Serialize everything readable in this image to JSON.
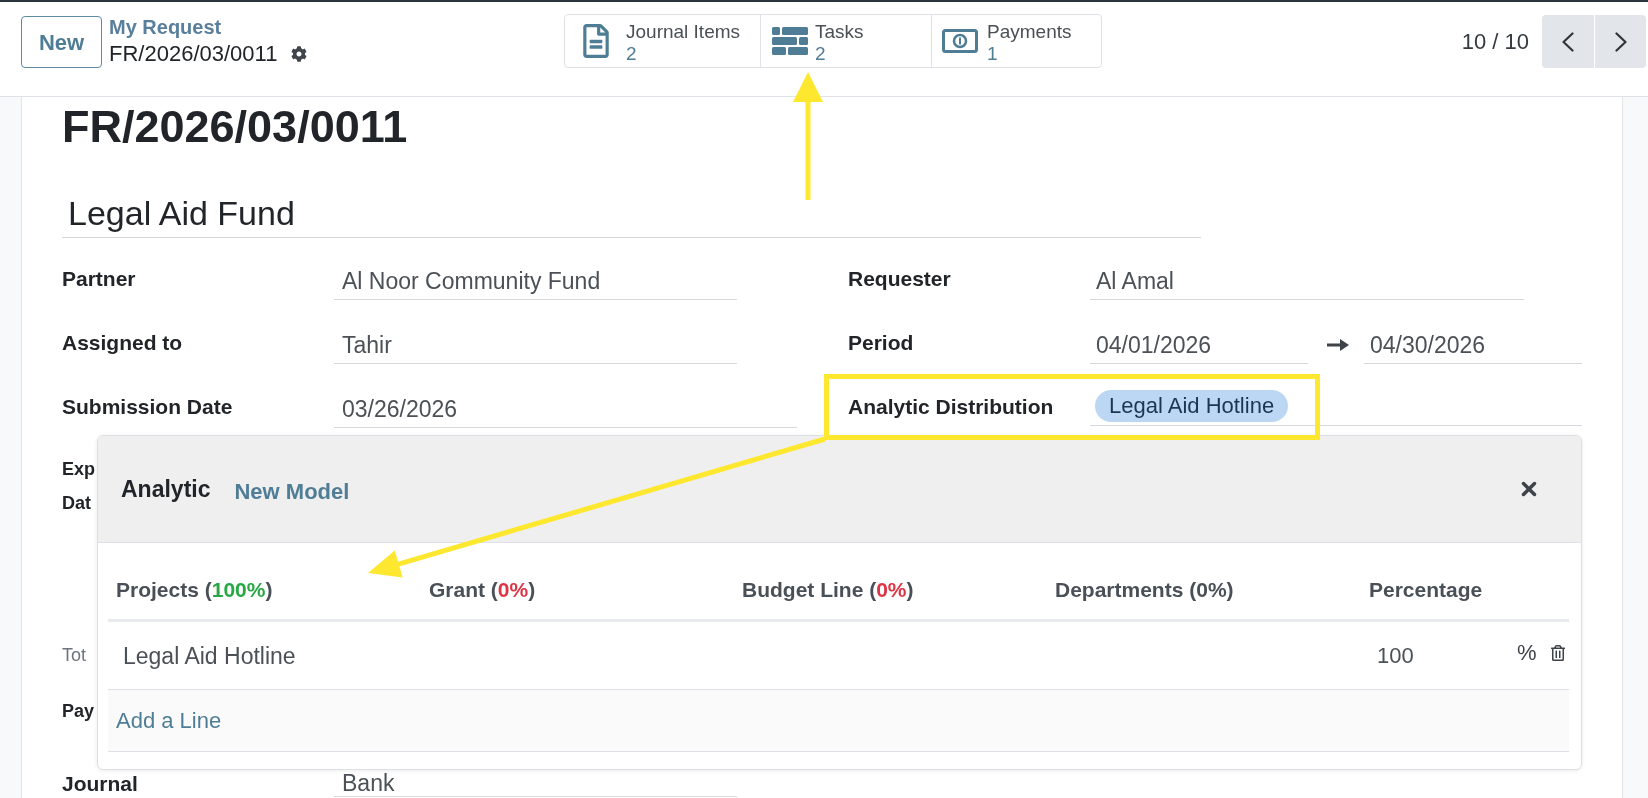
{
  "control_panel": {
    "new_button": "New",
    "breadcrumb": {
      "parent": "My Request",
      "current": "FR/2026/03/0011"
    },
    "smart_buttons": [
      {
        "kind": "journal",
        "label": "Journal Items",
        "count": "2",
        "arrow": false
      },
      {
        "kind": "tasks",
        "label": "Tasks",
        "count": "2",
        "arrow": true
      },
      {
        "kind": "payments",
        "label": "Payments",
        "count": "1",
        "arrow": false
      }
    ],
    "pager": "10 / 10"
  },
  "form": {
    "title": "FR/2026/03/0011",
    "name": "Legal Aid Fund",
    "left_fields": [
      {
        "label": "Partner",
        "value": "Al Noor Community Fund"
      },
      {
        "label": "Assigned to",
        "value": "Tahir"
      },
      {
        "label": "Submission Date",
        "value": "03/26/2026"
      }
    ],
    "right_fields": [
      {
        "kind": "text",
        "label": "Requester",
        "value": "Al Amal",
        "highlighted": false
      },
      {
        "kind": "range",
        "label": "Period",
        "start": "04/01/2026",
        "end": "04/30/2026",
        "highlighted": false
      },
      {
        "kind": "tags",
        "label": "Analytic Distribution",
        "tags": [
          "Legal Aid Hotline"
        ],
        "highlighted": true
      }
    ],
    "covered_fields": [
      {
        "kind": "field",
        "label_lines": [
          "Exp",
          "Dat"
        ]
      },
      {
        "kind": "section",
        "label_lines": [
          "Tot"
        ]
      },
      {
        "kind": "field",
        "label_lines": [
          "Pay"
        ]
      },
      {
        "kind": "field",
        "label_lines": [
          "Journal"
        ],
        "value": "Bank"
      }
    ]
  },
  "analytic_popup": {
    "title": "Analytic",
    "link": "New Model",
    "columns": [
      {
        "name": "Projects (",
        "share": "100%",
        "close": ")",
        "color": "#28a745"
      },
      {
        "name": "Grant (",
        "share": "0%",
        "close": ")",
        "color": "#dc3545"
      },
      {
        "name": "Budget Line (",
        "share": "0%",
        "close": ")",
        "color": "#dc3545"
      },
      {
        "name": "Departments (",
        "share": "0%",
        "close": ")",
        "color": "#495057"
      },
      {
        "name": "Percentage"
      }
    ],
    "rows": [
      {
        "account": "Legal Aid Hotline",
        "percentage": "100",
        "unit": "%"
      }
    ],
    "add_line": "Add a Line"
  },
  "annotations": [
    {
      "kind": "diagonal-arrow"
    }
  ]
}
